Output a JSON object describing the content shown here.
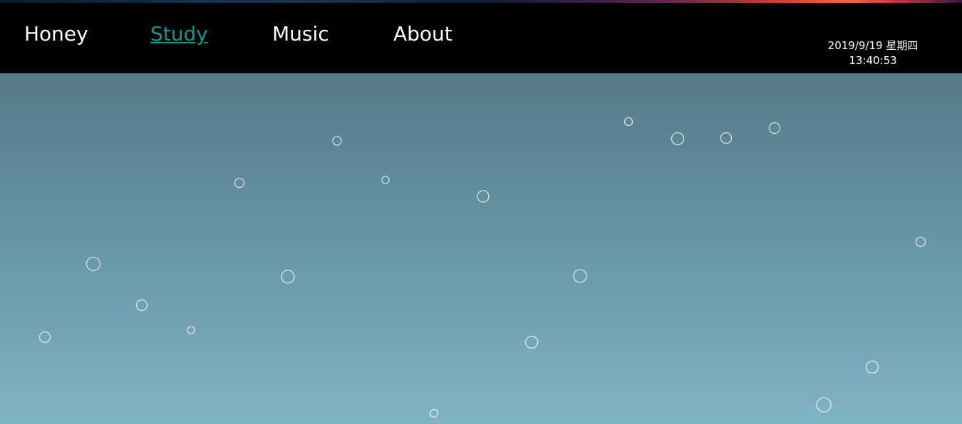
{
  "nav": {
    "items": [
      {
        "label": "Honey",
        "active": false
      },
      {
        "label": "Study",
        "active": true
      },
      {
        "label": "Music",
        "active": false
      },
      {
        "label": "About",
        "active": false
      }
    ],
    "active_color": "#17928c"
  },
  "clock": {
    "date": "2019/9/19 星期四",
    "time": "13:40:53"
  },
  "background": {
    "top_color": "#557a88",
    "bottom_color": "#80b3c4",
    "navbar_color": "#000000"
  }
}
